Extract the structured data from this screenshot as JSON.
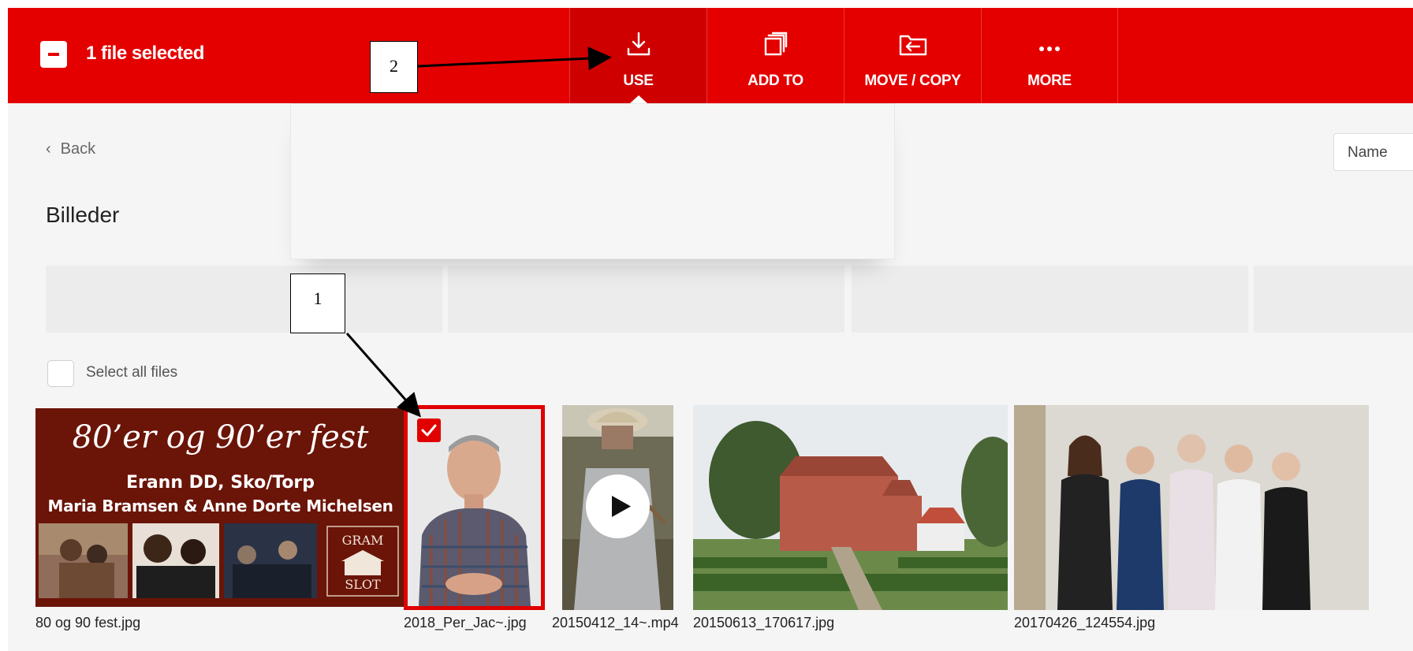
{
  "toolbar": {
    "selection_label": "1 file selected",
    "buttons": [
      {
        "label": "USE",
        "icon": "download-icon",
        "active": true
      },
      {
        "label": "ADD TO",
        "icon": "copy-stack-icon",
        "active": false
      },
      {
        "label": "MOVE / COPY",
        "icon": "move-folder-icon",
        "active": false
      },
      {
        "label": "MORE",
        "icon": "more-dots-icon",
        "active": false
      }
    ],
    "accent_color": "#e50000"
  },
  "nav": {
    "back_label": "Back",
    "folder_title": "Billeder",
    "sort_value": "Name"
  },
  "files": {
    "select_all_label": "Select all files",
    "items": [
      {
        "name": "80 og 90 fest.jpg",
        "selected": false,
        "type": "image"
      },
      {
        "name": "2018_Per_Jac~.jpg",
        "selected": true,
        "type": "image"
      },
      {
        "name": "20150412_14~.mp4",
        "selected": false,
        "type": "video"
      },
      {
        "name": "20150613_170617.jpg",
        "selected": false,
        "type": "image"
      },
      {
        "name": "20170426_124554.jpg",
        "selected": false,
        "type": "image"
      }
    ],
    "poster": {
      "headline": "80’er og 90’er fest",
      "line1": "Erann DD, Sko/Torp",
      "line2": "Maria Bramsen & Anne Dorte Michelsen",
      "logo_top": "GRAM",
      "logo_bottom": "SLOT"
    }
  },
  "annotations": [
    {
      "label": "1"
    },
    {
      "label": "2"
    }
  ]
}
